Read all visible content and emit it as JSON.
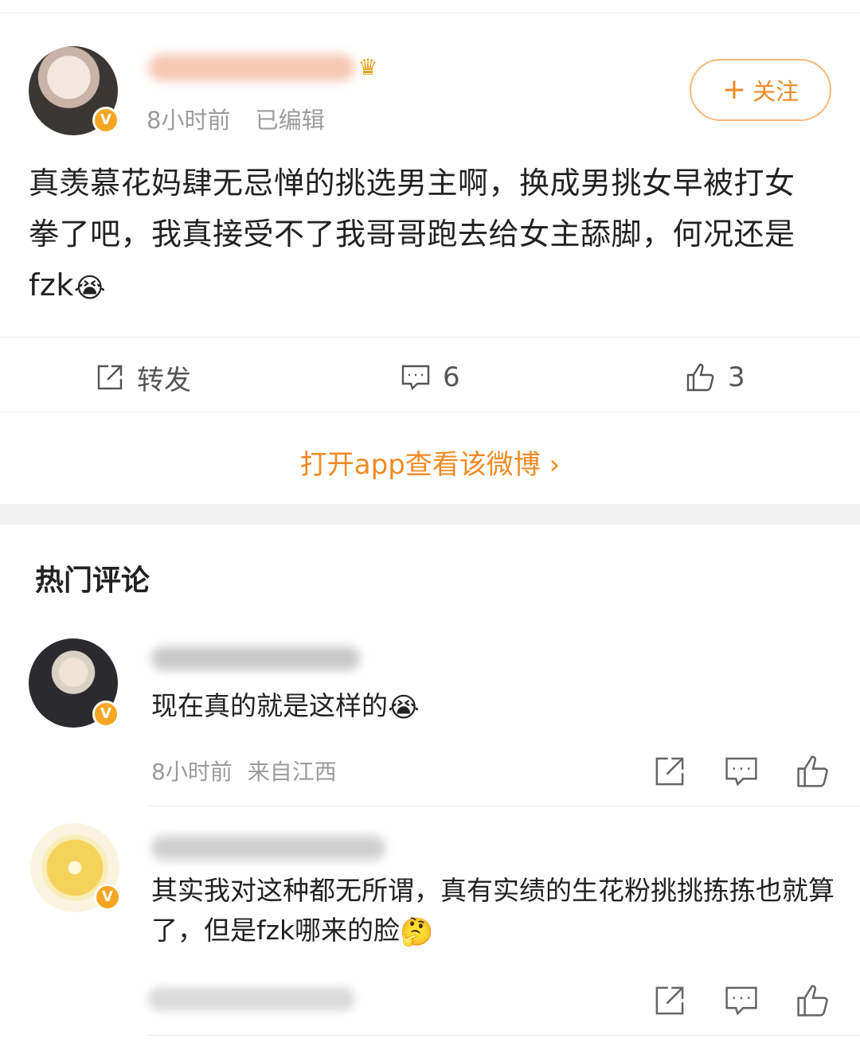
{
  "post": {
    "time": "8小时前",
    "edited": "已编辑",
    "follow_label": "关注",
    "text": "真羡慕花妈肆无忌惮的挑选男主啊，换成男挑女早被打女拳了吧，我真接受不了我哥哥跑去给女主舔脚，何况还是fzk",
    "emoji": "😭",
    "repost_label": "转发",
    "comment_count": "6",
    "like_count": "3",
    "open_app": "打开app查看该微博 ›",
    "verified_badge": "V"
  },
  "hot_comments": {
    "title": "热门评论",
    "items": [
      {
        "text": "现在真的就是这样的",
        "emoji": "😭",
        "time": "8小时前",
        "location": "来自江西",
        "verified_badge": "V"
      },
      {
        "text": "其实我对这种都无所谓，真有实绩的生花粉挑挑拣拣也就算了，但是fzk哪来的脸",
        "emoji": "🤔",
        "verified_badge": "V"
      }
    ]
  },
  "icons": {
    "repost": "share-icon",
    "comment": "comment-icon",
    "like": "thumbs-up-icon",
    "medal": "medal-icon"
  },
  "colors": {
    "accent": "#f08a24",
    "badge": "#f6a623",
    "muted": "#9b9b9b"
  }
}
